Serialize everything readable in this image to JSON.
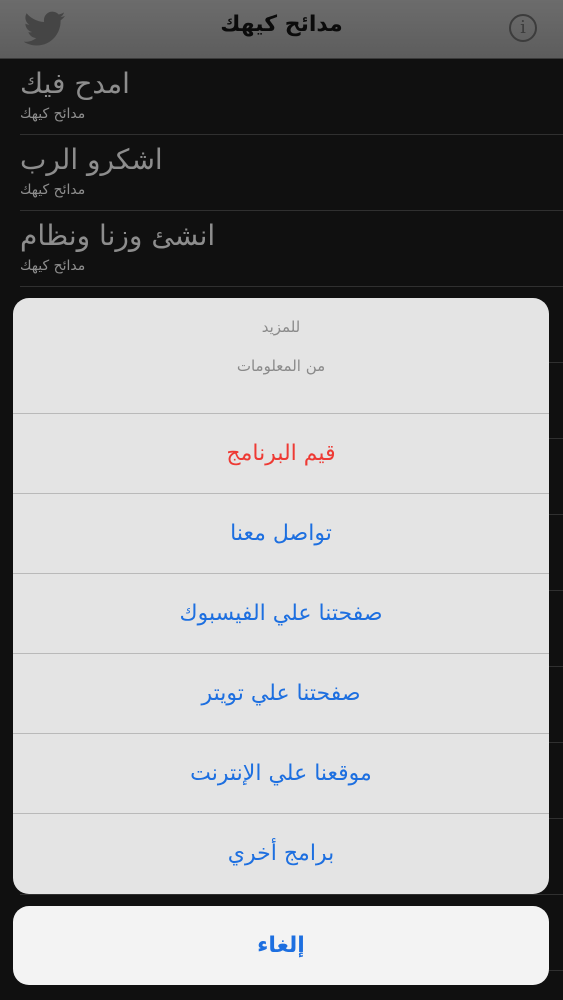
{
  "navbar": {
    "title": "مدائح كيهك",
    "left_icon": "twitter-icon",
    "right_icon": "info-icon",
    "info_glyph": "i"
  },
  "list": {
    "items": [
      {
        "title": "امدح فيك",
        "subtitle": "مدائح كيهك"
      },
      {
        "title": "اشكرو الرب",
        "subtitle": "مدائح كيهك"
      },
      {
        "title": "انشئ وزنا ونظام",
        "subtitle": "مدائح كيهك"
      }
    ]
  },
  "action_sheet": {
    "header_line1": "للمزيد",
    "header_line2": "من المعلومات",
    "actions": [
      {
        "label": "قيم البرنامج",
        "color": "#ee3a34"
      },
      {
        "label": "تواصل معنا",
        "color": "#1d6fe0"
      },
      {
        "label": "صفحتنا علي الفيسبوك",
        "color": "#1d6fe0"
      },
      {
        "label": "صفحتنا علي تويتر",
        "color": "#1d6fe0"
      },
      {
        "label": "موقعنا علي الإنترنت",
        "color": "#1d6fe0"
      },
      {
        "label": "برامج أخري",
        "color": "#1d6fe0"
      }
    ],
    "cancel_label": "إلغاء"
  }
}
